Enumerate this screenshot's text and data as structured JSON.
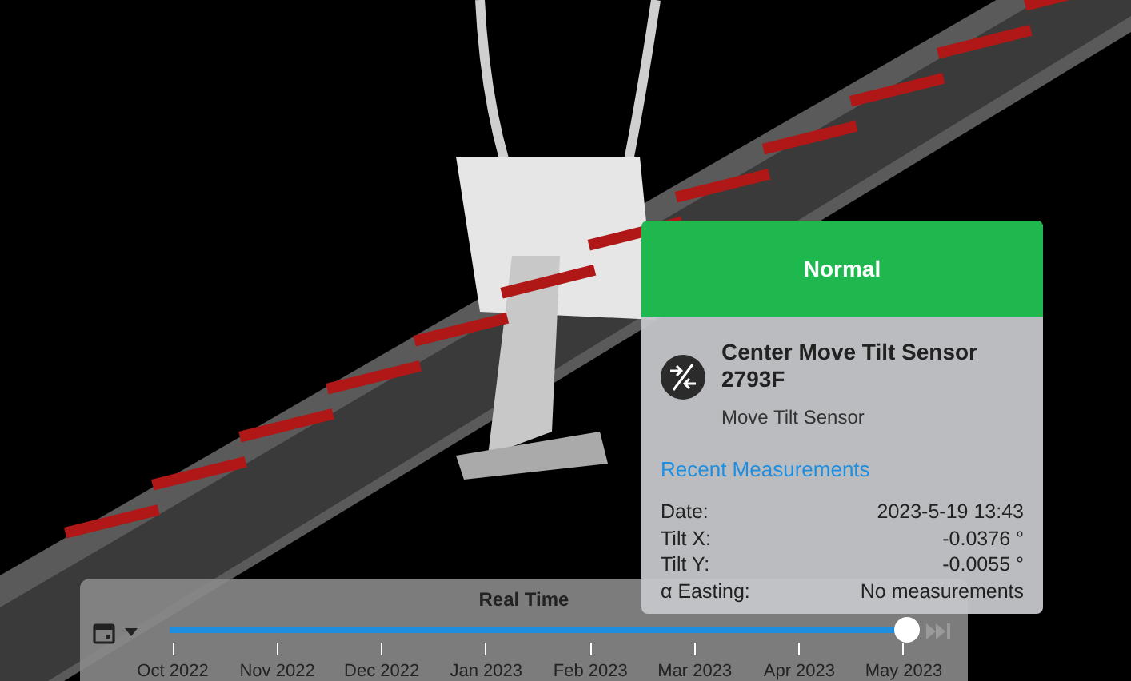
{
  "popup": {
    "status": "Normal",
    "title": "Center Move Tilt Sensor 2793F",
    "subtitle": "Move Tilt Sensor",
    "section": "Recent Measurements",
    "rows": [
      {
        "label": "Date:",
        "value": "2023-5-19 13:43"
      },
      {
        "label": "Tilt X:",
        "value": "-0.0376 °"
      },
      {
        "label": "Tilt Y:",
        "value": "-0.0055 °"
      },
      {
        "label": "α Easting:",
        "value": "No measurements"
      }
    ]
  },
  "timeline": {
    "title": "Real Time",
    "level": 1,
    "playback_disabled": true,
    "ticks": [
      "Oct 2022",
      "Nov 2022",
      "Dec 2022",
      "Jan 2023",
      "Feb 2023",
      "Mar 2023",
      "Apr 2023",
      "May 2023"
    ]
  }
}
